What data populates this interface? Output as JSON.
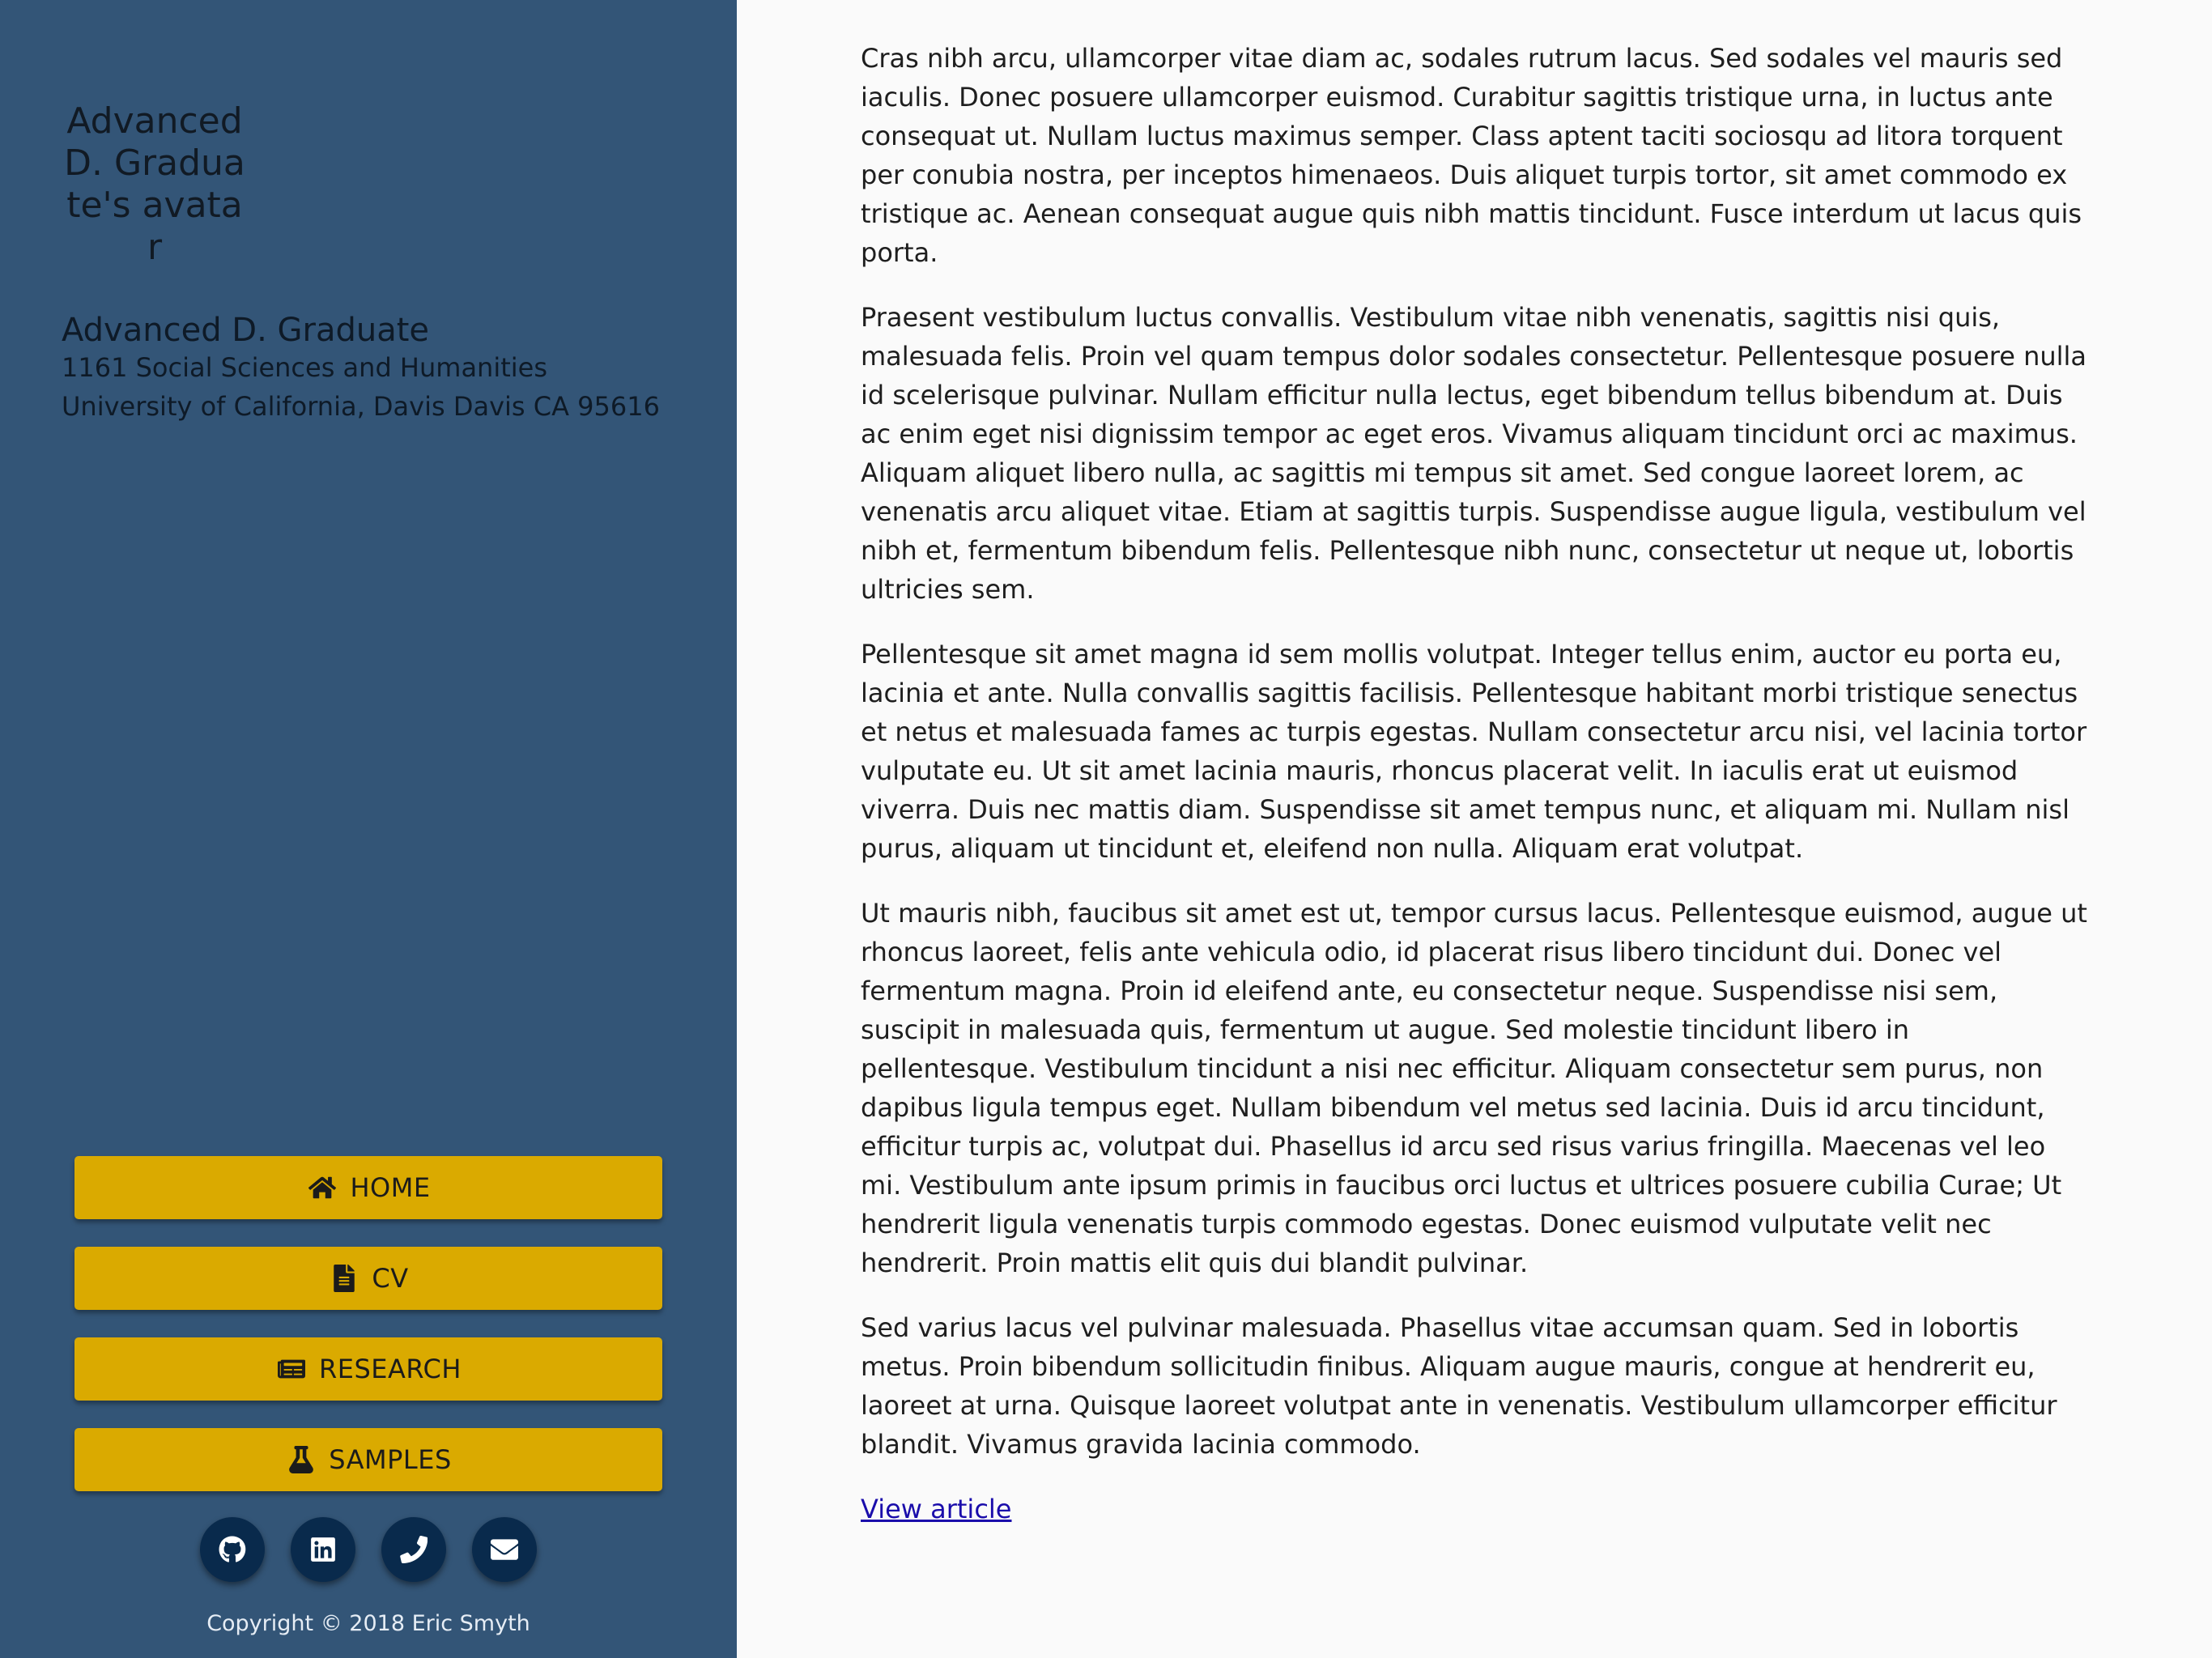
{
  "sidebar": {
    "avatar_alt": "Advanced D. Graduate's avatar",
    "name": "Advanced D. Graduate",
    "address": "1161 Social Sciences and Humanities University of California, Davis Davis CA 95616",
    "nav": [
      {
        "label": "HOME",
        "icon": "home-icon"
      },
      {
        "label": "CV",
        "icon": "file-icon"
      },
      {
        "label": "RESEARCH",
        "icon": "newspaper-icon"
      },
      {
        "label": "SAMPLES",
        "icon": "flask-icon"
      }
    ],
    "socials": [
      {
        "icon": "github-icon"
      },
      {
        "icon": "linkedin-icon"
      },
      {
        "icon": "phone-icon"
      },
      {
        "icon": "envelope-icon"
      }
    ],
    "copyright": "Copyright © 2018 Eric Smyth"
  },
  "main": {
    "paragraphs": [
      "Cras nibh arcu, ullamcorper vitae diam ac, sodales rutrum lacus. Sed sodales vel mauris sed iaculis. Donec posuere ullamcorper euismod. Curabitur sagittis tristique urna, in luctus ante consequat ut. Nullam luctus maximus semper. Class aptent taciti sociosqu ad litora torquent per conubia nostra, per inceptos himenaeos. Duis aliquet turpis tortor, sit amet commodo ex tristique ac. Aenean consequat augue quis nibh mattis tincidunt. Fusce interdum ut lacus quis porta.",
      "Praesent vestibulum luctus convallis. Vestibulum vitae nibh venenatis, sagittis nisi quis, malesuada felis. Proin vel quam tempus dolor sodales consectetur. Pellentesque posuere nulla id scelerisque pulvinar. Nullam efficitur nulla lectus, eget bibendum tellus bibendum at. Duis ac enim eget nisi dignissim tempor ac eget eros. Vivamus aliquam tincidunt orci ac maximus. Aliquam aliquet libero nulla, ac sagittis mi tempus sit amet. Sed congue laoreet lorem, ac venenatis arcu aliquet vitae. Etiam at sagittis turpis. Suspendisse augue ligula, vestibulum vel nibh et, fermentum bibendum felis. Pellentesque nibh nunc, consectetur ut neque ut, lobortis ultricies sem.",
      "Pellentesque sit amet magna id sem mollis volutpat. Integer tellus enim, auctor eu porta eu, lacinia et ante. Nulla convallis sagittis facilisis. Pellentesque habitant morbi tristique senectus et netus et malesuada fames ac turpis egestas. Nullam consectetur arcu nisi, vel lacinia tortor vulputate eu. Ut sit amet lacinia mauris, rhoncus placerat velit. In iaculis erat ut euismod viverra. Duis nec mattis diam. Suspendisse sit amet tempus nunc, et aliquam mi. Nullam nisl purus, aliquam ut tincidunt et, eleifend non nulla. Aliquam erat volutpat.",
      "Ut mauris nibh, faucibus sit amet est ut, tempor cursus lacus. Pellentesque euismod, augue ut rhoncus laoreet, felis ante vehicula odio, id placerat risus libero tincidunt dui. Donec vel fermentum magna. Proin id eleifend ante, eu consectetur neque. Suspendisse nisi sem, suscipit in malesuada quis, fermentum ut augue. Sed molestie tincidunt libero in pellentesque. Vestibulum tincidunt a nisi nec efficitur. Aliquam consectetur sem purus, non dapibus ligula tempus eget. Nullam bibendum vel metus sed lacinia. Duis id arcu tincidunt, efficitur turpis ac, volutpat dui. Phasellus id arcu sed risus varius fringilla. Maecenas vel leo mi. Vestibulum ante ipsum primis in faucibus orci luctus et ultrices posuere cubilia Curae; Ut hendrerit ligula venenatis turpis commodo egestas. Donec euismod vulputate velit nec hendrerit. Proin mattis elit quis dui blandit pulvinar.",
      "Sed varius lacus vel pulvinar malesuada. Phasellus vitae accumsan quam. Sed in lobortis metus. Proin bibendum sollicitudin finibus. Aliquam augue mauris, congue at hendrerit eu, laoreet at urna. Quisque laoreet volutpat ante in venenatis. Vestibulum ullamcorper efficitur blandit. Vivamus gravida lacinia commodo."
    ],
    "link_label": "View article"
  },
  "colors": {
    "sidebar_bg": "#335577",
    "button_bg": "#daaa00",
    "social_bg": "#092a4c",
    "page_bg": "#fafafa",
    "link": "#1a0dab"
  }
}
